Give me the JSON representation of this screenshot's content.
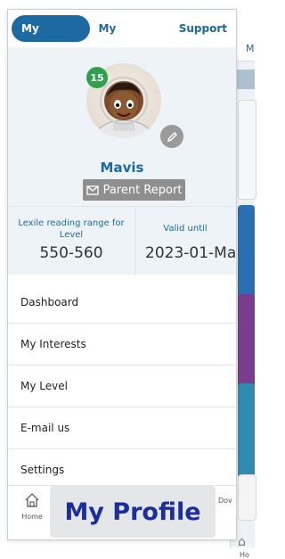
{
  "tabs": [
    "My Profile",
    "My History",
    "Support"
  ],
  "profile": {
    "level_badge": "15",
    "name": "Mavis",
    "parent_report_label": "Parent Report",
    "lexile_label": "Lexile reading range for Level",
    "lexile_value": "550-560",
    "valid_until_label": "Valid until",
    "valid_until_value": "2023-01-Ma"
  },
  "menu": [
    "Dashboard",
    "My Interests",
    "My Level",
    "E-mail us",
    "Settings"
  ],
  "bottom_nav": {
    "home_label": "Home",
    "right_label": "Dov"
  },
  "overlay_caption": "My Profile",
  "peek": {
    "tab_letter": "M",
    "home_label": "Ho"
  },
  "colors": {
    "accent": "#1d6aa3",
    "badge_green": "#2fa04e",
    "button_gray": "#8f8f8f",
    "panel_bg": "#eef3f7",
    "overlay_text": "#1b2ea0"
  }
}
